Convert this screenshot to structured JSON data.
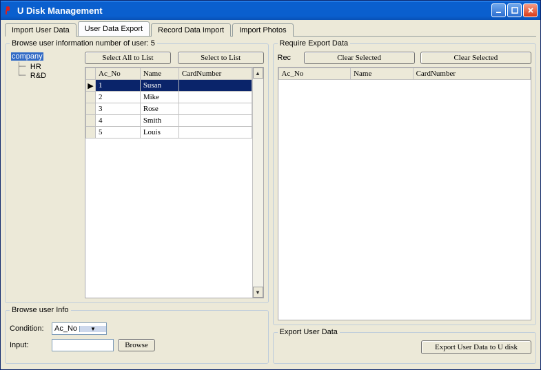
{
  "window": {
    "title": "U Disk Management"
  },
  "tabs": [
    {
      "label": "Import User Data"
    },
    {
      "label": "User Data Export"
    },
    {
      "label": "Record Data Import"
    },
    {
      "label": "Import Photos"
    }
  ],
  "browse_group": {
    "legend": "Browse user information  number of user: 5",
    "select_all_btn": "Select All to List",
    "select_btn": "Select to List",
    "tree": {
      "root": "company",
      "children": [
        "HR",
        "R&D"
      ]
    },
    "grid": {
      "columns": [
        "Ac_No",
        "Name",
        "CardNumber"
      ],
      "rows": [
        {
          "ac_no": "1",
          "name": "Susan",
          "card": ""
        },
        {
          "ac_no": "2",
          "name": "Mike",
          "card": ""
        },
        {
          "ac_no": "3",
          "name": "Rose",
          "card": ""
        },
        {
          "ac_no": "4",
          "name": "Smith",
          "card": ""
        },
        {
          "ac_no": "5",
          "name": "Louis",
          "card": ""
        }
      ]
    }
  },
  "browse_info": {
    "legend": "Browse user Info",
    "condition_label": "Condition:",
    "condition_value": "Ac_No",
    "input_label": "Input:",
    "input_value": "",
    "browse_btn": "Browse"
  },
  "require_export": {
    "legend": "Require Export Data",
    "rec_label": "Rec",
    "clear1_btn": "Clear Selected",
    "clear2_btn": "Clear Selected",
    "grid": {
      "columns": [
        "Ac_No",
        "Name",
        "CardNumber"
      ]
    }
  },
  "export_user": {
    "legend": "Export User Data",
    "export_btn": "Export User Data to U disk"
  }
}
